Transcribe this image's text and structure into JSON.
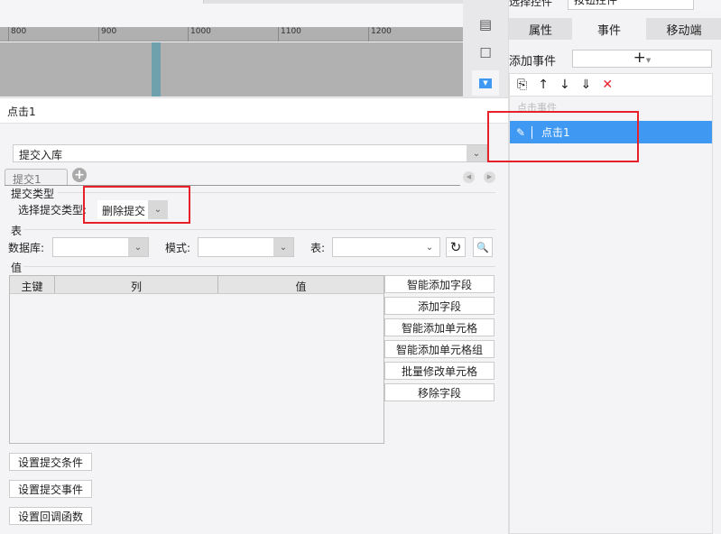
{
  "ruler": {
    "ticks": [
      "800",
      "900",
      "1000",
      "1100",
      "1200"
    ]
  },
  "editor": {
    "title": "点击1"
  },
  "submit": {
    "action_select": "提交入库",
    "tab_label": "提交1",
    "type_section": "提交类型",
    "type_label": "选择提交类型:",
    "type_value": "删除提交",
    "table_section": "表",
    "db_label": "数据库:",
    "schema_label": "模式:",
    "table_label": "表:",
    "value_section": "值",
    "columns": [
      "主键",
      "列",
      "值"
    ],
    "side_buttons": [
      "智能添加字段",
      "添加字段",
      "智能添加单元格",
      "智能添加单元格组",
      "批量修改单元格",
      "移除字段"
    ],
    "bottom_buttons": [
      "设置提交条件",
      "设置提交事件",
      "设置回调函数"
    ]
  },
  "right": {
    "select_label": "选择控件",
    "select_value": "按钮控件",
    "tabs": [
      "属性",
      "事件",
      "移动端"
    ],
    "add_event_label": "添加事件",
    "event_group": "点击事件",
    "event_item": "点击1"
  },
  "colors": {
    "accent": "#3f98f2",
    "highlight": "#e8202a"
  }
}
